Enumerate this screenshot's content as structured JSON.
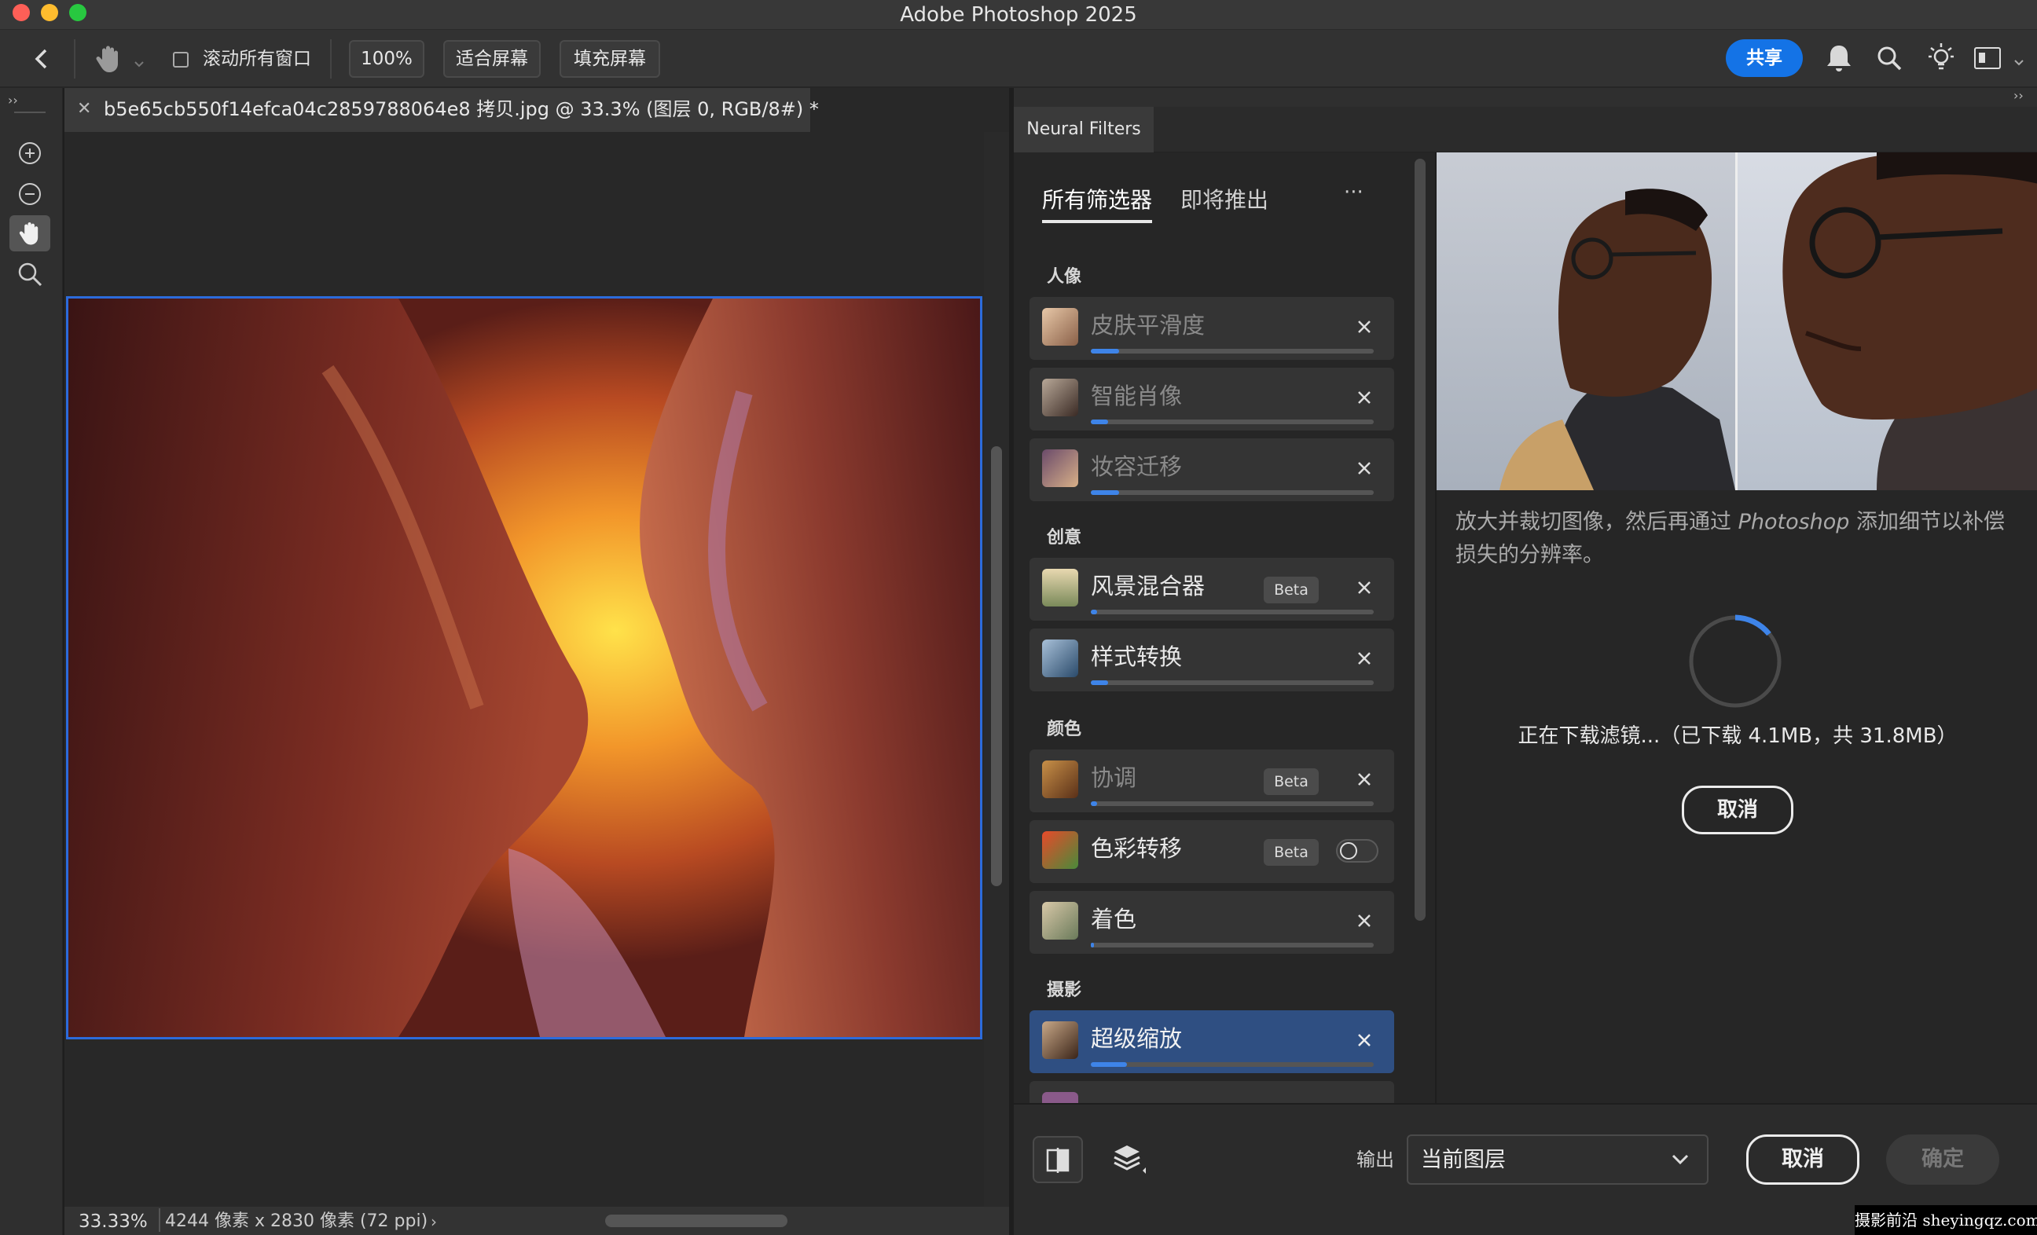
{
  "window": {
    "title": "Adobe Photoshop 2025"
  },
  "options_bar": {
    "scroll_all": "滚动所有窗口",
    "zoom_100": "100%",
    "fit_screen": "适合屏幕",
    "fill_screen": "填充屏幕",
    "share": "共享"
  },
  "document": {
    "tab_title": "b5e65cb550f14efca04c2859788064e8 拷贝.jpg @ 33.3% (图层 0, RGB/8#) *",
    "zoom": "33.33%",
    "dimensions": "4244 像素 x 2830 像素 (72 ppi)"
  },
  "neural_filters": {
    "panel_title": "Neural Filters",
    "tab_all": "所有筛选器",
    "tab_coming": "即将推出",
    "more": "···",
    "categories": {
      "portrait": "人像",
      "creative": "创意",
      "color": "颜色",
      "photo": "摄影"
    },
    "filters": [
      {
        "label": "皮肤平滑度",
        "state": "download",
        "progress": 0.1
      },
      {
        "label": "智能肖像",
        "state": "download",
        "progress": 0.06
      },
      {
        "label": "妆容迁移",
        "state": "download",
        "progress": 0.1
      },
      {
        "label": "风景混合器",
        "badge": "Beta",
        "state": "download",
        "progress": 0.02
      },
      {
        "label": "样式转换",
        "state": "download",
        "progress": 0.06
      },
      {
        "label": "协调",
        "badge": "Beta",
        "state": "download",
        "progress": 0.02
      },
      {
        "label": "色彩转移",
        "badge": "Beta",
        "state": "toggle-off"
      },
      {
        "label": "着色",
        "state": "download",
        "progress": 0.01
      },
      {
        "label": "超级缩放",
        "state": "selected",
        "progress": 0.13
      }
    ],
    "description_part1": "放大并裁切图像，然后再通过 ",
    "description_italic": "Photoshop",
    "description_part2": " 添加细节以补偿损失的分辨率。",
    "download_status": "正在下载滤镜...（已下载 4.1MB，共 31.8MB）",
    "download_progress": 0.13,
    "cancel_download": "取消",
    "output_label": "输出",
    "output_value": "当前图层",
    "cancel": "取消",
    "ok": "确定"
  },
  "watermark": "摄影前沿 sheyingqz.com",
  "colors": {
    "accent": "#1473e6",
    "selection": "#2f4f82",
    "progress": "#3e84e8"
  }
}
